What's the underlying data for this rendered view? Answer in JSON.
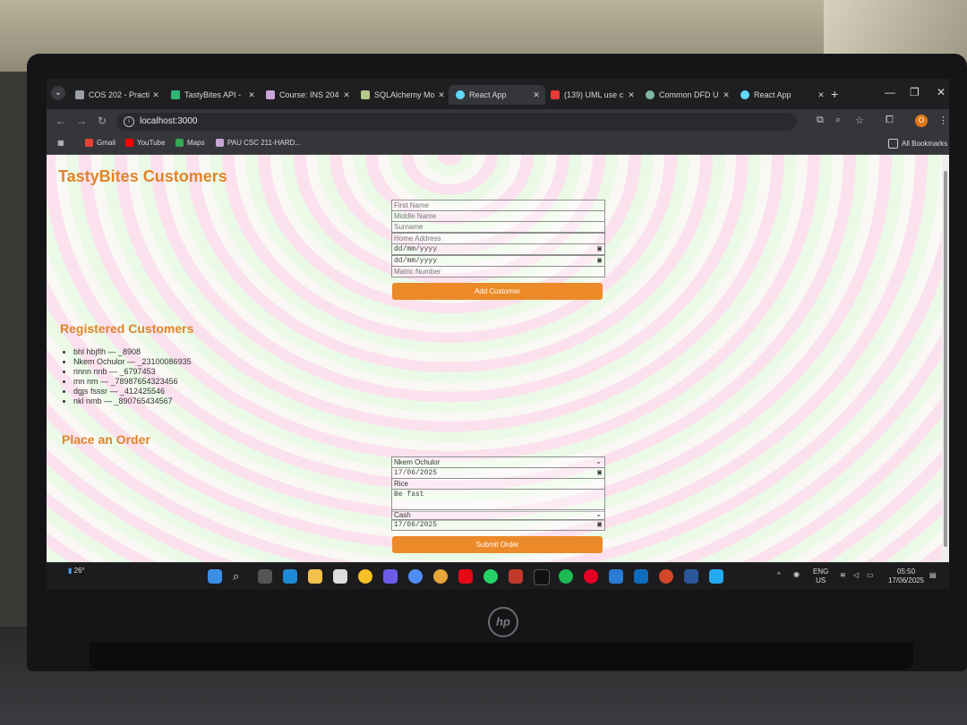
{
  "browser": {
    "tabs": [
      {
        "title": "COS 202 - Practi",
        "color": "#9aa0a6",
        "active": false
      },
      {
        "title": "TastyBites API - ",
        "color": "#2bb673",
        "active": false
      },
      {
        "title": "Course: INS 204",
        "color": "#c9a6d8",
        "active": false
      },
      {
        "title": "SQLAlchemy Mo",
        "color": "#b5c98a",
        "active": false
      },
      {
        "title": "React App",
        "color": "#61dafb",
        "active": true
      },
      {
        "title": "(139) UML use c",
        "color": "#e53935",
        "active": false
      },
      {
        "title": "Common DFD U",
        "color": "#7fb7a2",
        "active": false
      },
      {
        "title": "React App",
        "color": "#61dafb",
        "active": false
      }
    ],
    "url": "localhost:3000",
    "profile_initial": "O",
    "bookmarks": [
      {
        "label": "Gmail",
        "color": "#ea4335"
      },
      {
        "label": "YouTube",
        "color": "#ff0000"
      },
      {
        "label": "Maps",
        "color": "#34a853"
      },
      {
        "label": "PAU CSC 211-HARD...",
        "color": "#c9a6d8"
      }
    ],
    "all_bookmarks": "All Bookmarks"
  },
  "page": {
    "title": "TastyBites Customers",
    "customer_form": {
      "first_name": "First Name",
      "middle_name": "Middle Name",
      "surname": "Surname",
      "home_address": "Home Address",
      "date1": "dd/mm/yyyy",
      "date2": "dd/mm/yyyy",
      "matric_number": "Matric Number",
      "submit": "Add Customer"
    },
    "registered_heading": "Registered Customers",
    "customers": [
      "bhl hbjflh — _8908",
      "Nkem Ochulor — _23100086935",
      "nnnn nnb — _6797453",
      "mn nm — _78987654323456",
      "dgjs fsssr — _412425546",
      "nkl nmb — _890765434567"
    ],
    "order_heading": "Place an Order",
    "order_form": {
      "customer": "Nkem Ochulor",
      "order_date": "17/06/2025",
      "item": "Rice",
      "notes": "Be fast",
      "payment": "Cash",
      "delivery_date": "17/06/2025",
      "submit": "Submit Order"
    }
  },
  "taskbar": {
    "weather": "26°",
    "language": "ENG",
    "region": "US",
    "time": "05:50",
    "date": "17/06/2025"
  }
}
